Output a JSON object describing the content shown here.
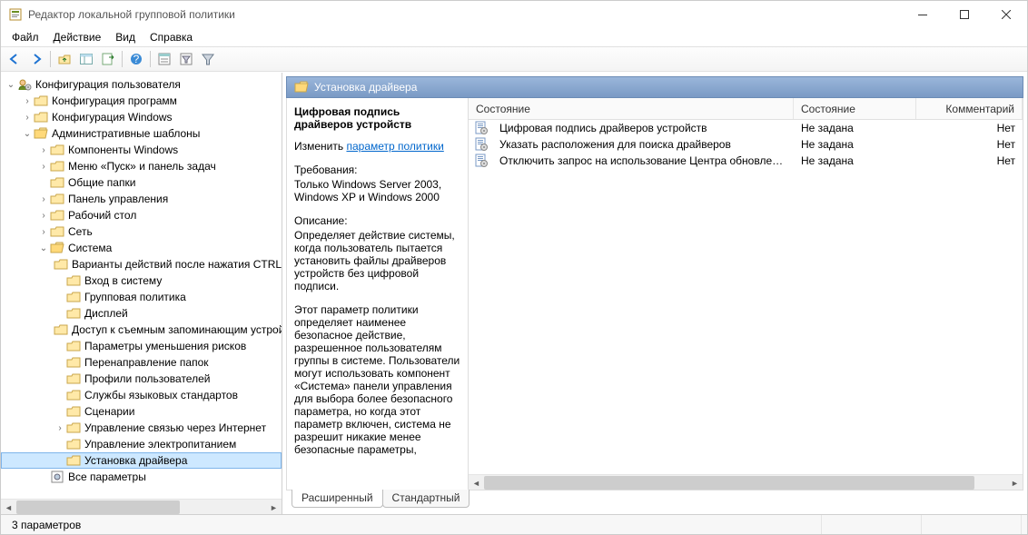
{
  "window": {
    "title": "Редактор локальной групповой политики"
  },
  "menubar": {
    "items": [
      "Файл",
      "Действие",
      "Вид",
      "Справка"
    ]
  },
  "toolbar": {
    "icons": [
      "back-arrow-icon",
      "forward-arrow-icon",
      "up-level-icon",
      "show-hide-tree-icon",
      "export-list-icon",
      "help-icon",
      "properties-icon",
      "filter-options-icon",
      "filter-icon"
    ]
  },
  "tree": {
    "root": {
      "label": "Конфигурация пользователя",
      "expanded": true,
      "children": [
        {
          "label": "Конфигурация программ",
          "hasChildren": true
        },
        {
          "label": "Конфигурация Windows",
          "hasChildren": true
        },
        {
          "label": "Административные шаблоны",
          "hasChildren": true,
          "expanded": true,
          "children": [
            {
              "label": "Компоненты Windows",
              "hasChildren": true
            },
            {
              "label": "Меню «Пуск» и панель задач",
              "hasChildren": true
            },
            {
              "label": "Общие папки"
            },
            {
              "label": "Панель управления",
              "hasChildren": true
            },
            {
              "label": "Рабочий стол",
              "hasChildren": true
            },
            {
              "label": "Сеть",
              "hasChildren": true
            },
            {
              "label": "Система",
              "hasChildren": true,
              "expanded": true,
              "children": [
                {
                  "label": "Варианты действий после нажатия CTRL+ALT+DEL"
                },
                {
                  "label": "Вход в систему"
                },
                {
                  "label": "Групповая политика"
                },
                {
                  "label": "Дисплей"
                },
                {
                  "label": "Доступ к съемным запоминающим устройствам"
                },
                {
                  "label": "Параметры уменьшения рисков"
                },
                {
                  "label": "Перенаправление папок"
                },
                {
                  "label": "Профили пользователей"
                },
                {
                  "label": "Службы языковых стандартов"
                },
                {
                  "label": "Сценарии"
                },
                {
                  "label": "Управление связью через Интернет",
                  "hasChildren": true
                },
                {
                  "label": "Управление электропитанием"
                },
                {
                  "label": "Установка драйвера",
                  "selected": true
                }
              ]
            },
            {
              "label": "Все параметры",
              "iconVariant": "settings"
            }
          ]
        }
      ]
    }
  },
  "rightPane": {
    "headerTitle": "Установка драйвера",
    "description": {
      "title": "Цифровая подпись драйверов устройств",
      "editLabel": "Изменить ",
      "editLink": "параметр политики",
      "requirementsLabel": "Требования:",
      "requirementsText": "Только Windows Server 2003, Windows XP и Windows 2000",
      "descriptionLabel": "Описание:",
      "descriptionText": "Определяет действие системы, когда пользователь пытается установить файлы драйверов устройств без цифровой подписи.",
      "descriptionPara2": "Этот параметр политики определяет наименее безопасное действие, разрешенное пользователям группы в системе. Пользователи могут использовать компонент «Система» панели управления для выбора более безопасного параметра, но когда этот параметр включен, система не разрешит никакие менее безопасные параметры,"
    },
    "columns": {
      "c1": "Состояние",
      "c2": "Состояние",
      "c3": "Комментарий"
    },
    "rows": [
      {
        "name": "Цифровая подпись драйверов устройств",
        "state": "Не задана",
        "comment": "Нет",
        "icon": "policy"
      },
      {
        "name": "Указать расположения для поиска драйверов",
        "state": "Не задана",
        "comment": "Нет",
        "icon": "policy"
      },
      {
        "name": "Отключить запрос на использование Центра обновлени...",
        "state": "Не задана",
        "comment": "Нет",
        "icon": "policy"
      }
    ],
    "tabs": {
      "extended": "Расширенный",
      "standard": "Стандартный"
    }
  },
  "statusbar": {
    "text": "3 параметров"
  }
}
